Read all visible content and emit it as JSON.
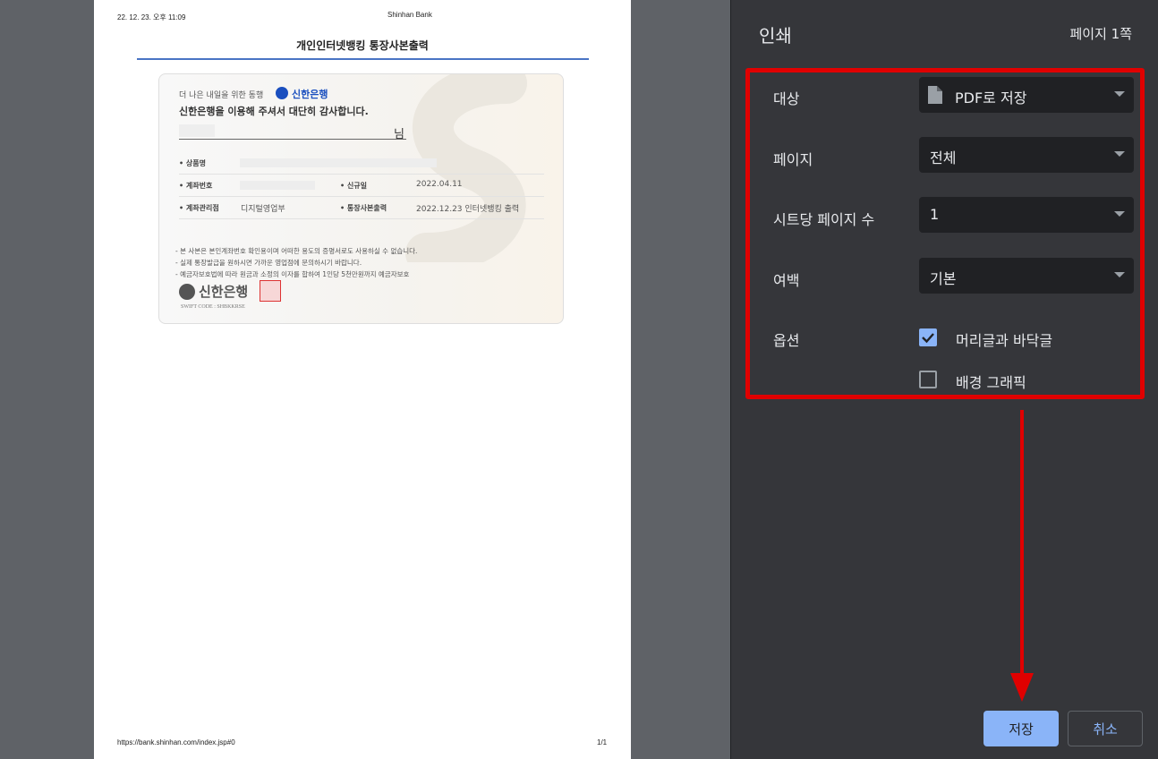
{
  "sheet": {
    "header_date": "22. 12. 23. 오후 11:09",
    "header_site": "Shinhan Bank",
    "title": "개인인터넷뱅킹 통장사본출력",
    "footer_url": "https://bank.shinhan.com/index.jsp#0",
    "footer_page": "1/1",
    "card": {
      "greeting_prefix": "더 나은 내일을 위한 동행",
      "brand": "신한은행",
      "greeting_main": "신한은행을 이용해 주셔서 대단히 감사합니다.",
      "name_suffix": "님",
      "product_label": "• 상품명",
      "account_label": "• 계좌번호",
      "opened_label": "• 신규일",
      "opened_value": "2022.04.11",
      "branch_label": "• 계좌관리점",
      "branch_value": "디지털영업부",
      "printed_label": "• 통장사본출력",
      "printed_value": "2022.12.23 인터넷뱅킹 출력",
      "notes": [
        "- 본 사본은 본인계좌번호 확인용이며 어떠한 용도의 증명서로도 사용하실 수 없습니다.",
        "- 실제 통장발급을 원하시면 가까운 영업점에 문의하시기 바랍니다.",
        "- 예금자보호법에 따라 원금과 소정의 이자를 합하여 1인당 5천만원까지 예금자보호"
      ],
      "logo_text": "신한은행",
      "swift": "SWIFT CODE : SHBKKRSE"
    }
  },
  "panel": {
    "title": "인쇄",
    "page_count": "페이지 1쪽",
    "destination_label": "대상",
    "destination_value": "PDF로 저장",
    "pages_label": "페이지",
    "pages_value": "전체",
    "per_sheet_label": "시트당 페이지 수",
    "per_sheet_value": "1",
    "margins_label": "여백",
    "margins_value": "기본",
    "options_label": "옵션",
    "option_headers_footers": "머리글과 바닥글",
    "option_headers_footers_checked": true,
    "option_background": "배경 그래픽",
    "option_background_checked": false,
    "save_label": "저장",
    "cancel_label": "취소"
  },
  "colors": {
    "highlight": "#e00000",
    "accent": "#8ab4f8",
    "panel_bg": "#35363a"
  },
  "icons": [
    "file-icon",
    "dropdown-caret-icon",
    "checkbox-checked-icon",
    "checkbox-empty-icon",
    "red-arrow-annotation"
  ]
}
